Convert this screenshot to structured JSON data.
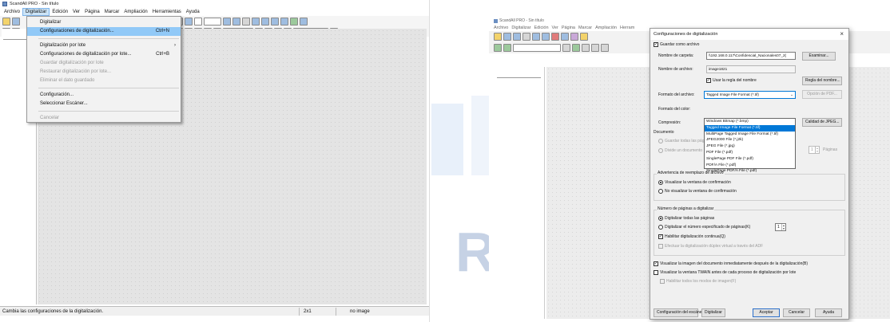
{
  "left": {
    "title": "ScandAll PRO - Sin título",
    "menubar": [
      "Archivo",
      "Digitalizar",
      "Edición",
      "Ver",
      "Página",
      "Marcar",
      "Ampliación",
      "Herramientas",
      "Ayuda"
    ],
    "menu": {
      "items": [
        {
          "label": "Digitalizar",
          "shortcut": "",
          "state": "normal"
        },
        {
          "label": "Configuraciones de digitalización...",
          "shortcut": "Ctrl+N",
          "state": "selected"
        },
        {
          "sep": true
        },
        {
          "label": "Digitalización por lote",
          "shortcut": "",
          "state": "normal",
          "submenu": true
        },
        {
          "label": "Configuraciones de digitalización por lote...",
          "shortcut": "Ctrl+B",
          "state": "normal"
        },
        {
          "label": "Guardar digitalización por lote",
          "shortcut": "",
          "state": "disabled"
        },
        {
          "label": "Restaurar digitalización por lote...",
          "shortcut": "",
          "state": "disabled"
        },
        {
          "label": "Eliminar el dato guardado",
          "shortcut": "",
          "state": "disabled"
        },
        {
          "sep": true
        },
        {
          "label": "Configuración...",
          "shortcut": "",
          "state": "normal"
        },
        {
          "label": "Seleccionar Escáner...",
          "shortcut": "",
          "state": "normal"
        },
        {
          "sep": true
        },
        {
          "label": "Cancelar",
          "shortcut": "",
          "state": "disabled"
        }
      ]
    },
    "zoom_value": "2x1",
    "status": {
      "text": "Cambia las configuraciones de la digitalización.",
      "scale": "2x1",
      "image": "no image"
    }
  },
  "right": {
    "title": "ScandAll PRO - Sin título",
    "menubar": [
      "Archivo",
      "Digitalizar",
      "Edición",
      "Ver",
      "Página",
      "Marcar",
      "Ampliación",
      "Herram"
    ],
    "dialog": {
      "title": "Configuraciones de digitalización",
      "close": "×",
      "save_as_file": "Guardar como archivo",
      "folder_label": "Nombre de carpeta:",
      "folder_value": "\\\\192.168.0.117\\Confidencial_Nacionales07_2(",
      "browse": "Examinar...",
      "filename_label": "Nombre de archivo:",
      "filename_value": "image1821",
      "use_naming_rule": "Usar la regla del nombre",
      "naming_rule_button": "Regla del nombre...",
      "format_label": "Formato del archivo:",
      "format_value": "Tagged Image File Format (*.tif)",
      "pdf_option_button": "Opción de PDF...",
      "format_options": [
        "Windows Bitmap (*.bmp)",
        "Tagged Image File Format (*.tif)",
        "MultiPage Tagged Image File Format (*.tif)",
        "JPEG2000 File (*.j2k)",
        "JPEG File (*.jpg)",
        "PDF File (*.pdf)",
        "SinglePage PDF File (*.pdf)",
        "PDF/A File (*.pdf)",
        "SinglePage PDF/A File (*.pdf)"
      ],
      "color_label": "Formato del color:",
      "compression_label": "Compresión:",
      "jpeg_quality_button": "Calidad de JPEG...",
      "document_group": "Documento",
      "doc_opt1": "Guardar todas las pág",
      "doc_opt2": "Divide un documento",
      "pages_label": "Páginas",
      "pages_value": "1",
      "overwrite_group": "Advertencia de reemplazo de archivo",
      "overwrite_opt1": "Visualizar la ventana de confirmación",
      "overwrite_opt2": "No visualizar la ventana de confirmación",
      "pages_group": "Número de páginas a digitalizar",
      "pages_opt1": "Digitalizar todas las páginas",
      "pages_opt2": "Digitalizar el número especificado de páginas(K)",
      "pages_count": "1",
      "continuous": "Habilitar digitalización continua(Q)",
      "duplex": "Efectuar la digitalización dúplex virtual a través del ADF",
      "show_image": "Visualizar la imagen del documento inmediatamente después de la digitalización(B)",
      "show_twain": "Visualizar la ventana TWAIN antes de cada proceso de digitalización por lote",
      "enable_all": "Habilitar todos los modos de imagen(F)",
      "btn_scanner_config": "Configuración del escáner...",
      "btn_scan": "Digitalizar",
      "btn_accept": "Aceptar",
      "btn_cancel": "Cancelar",
      "btn_help": "Ayuda"
    }
  }
}
